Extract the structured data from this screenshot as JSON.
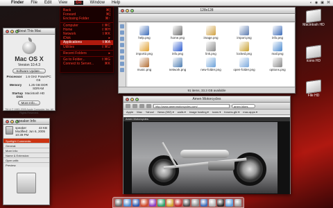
{
  "menubar": {
    "apple": "",
    "app": "Finder",
    "items": [
      "File",
      "Edit",
      "View",
      "Go",
      "Window",
      "Help"
    ],
    "right_glyphs": [
      "◐",
      "◉",
      "▣",
      "⌘"
    ]
  },
  "go_menu": {
    "items": [
      {
        "label": "Back",
        "key": "⌘["
      },
      {
        "label": "Forward",
        "key": "⌘]"
      },
      {
        "label": "Enclosing Folder",
        "key": "⌘↑"
      },
      {
        "sep": true
      },
      {
        "label": "Computer",
        "key": "⇧⌘C"
      },
      {
        "label": "Home",
        "key": "⇧⌘H"
      },
      {
        "label": "Network",
        "key": "⇧⌘K"
      },
      {
        "label": "iDisk",
        "key": "▸"
      },
      {
        "label": "Applications",
        "key": "⇧⌘A"
      },
      {
        "label": "Utilities",
        "key": "⇧⌘U"
      },
      {
        "sep": true
      },
      {
        "label": "Recent Folders",
        "key": "▸"
      },
      {
        "sep": true
      },
      {
        "label": "Go to Folder...",
        "key": "⇧⌘G"
      },
      {
        "label": "Connect to Server...",
        "key": "⌘K"
      }
    ],
    "highlighted": "Applications"
  },
  "about": {
    "title": "About This Mac",
    "os": "Mac OS X",
    "version": "Version 10.4.3",
    "update_btn": "Software Update...",
    "rows": [
      {
        "k": "Processor",
        "v": "1.6 GHz PowerPC G5"
      },
      {
        "k": "Memory",
        "v": "1.25 GB DDR SDRAM"
      },
      {
        "k": "Startup Disk",
        "v": "Macintosh HD"
      }
    ],
    "more_btn": "More Info...",
    "footer": "TM & © 1983-2005 Apple Computer, Inc. All Rights Reserved."
  },
  "finder": {
    "title": "128x128",
    "status": "91 items, 33.3 GB available",
    "files": [
      {
        "name": "help.png",
        "color": "#3a6ab8"
      },
      {
        "name": "home.png",
        "color": "#6a6a6a"
      },
      {
        "name": "image.png",
        "color": "#d0a040"
      },
      {
        "name": "import.png",
        "color": "#5a7ab0"
      },
      {
        "name": "info.png",
        "color": "#3a6ab8"
      },
      {
        "name": "import2.png",
        "color": "#e0a030"
      },
      {
        "name": "info.png",
        "color": "#2a5ad0"
      },
      {
        "name": "link.png",
        "color": "#8a8a8a"
      },
      {
        "name": "locked.png",
        "color": "#c8a030"
      },
      {
        "name": "mail.png",
        "color": "#4a8ad0"
      },
      {
        "name": "music.png",
        "color": "#b06a30"
      },
      {
        "name": "network.png",
        "color": "#4a7ab0"
      },
      {
        "name": "new-folder.png",
        "color": "#6aa0d8"
      },
      {
        "name": "open-folder.png",
        "color": "#7aa8dc"
      },
      {
        "name": "options.png",
        "color": "#888888"
      }
    ]
  },
  "speaker_info": {
    "title": "speaker Info",
    "name": "speaker",
    "size": "43 KB",
    "modified": "Modified: Jun 6, 2005 10:39 PM",
    "sections": [
      "Spotlight Comments:",
      "General:",
      "More Info:",
      "Name & Extension:",
      "Open with:",
      "Preview:"
    ],
    "highlighted": "Spotlight Comments:"
  },
  "browser": {
    "title": "Amen Motorcycles",
    "url": "http://www.amenmotorcycles.com/",
    "search": "amen bikes",
    "bookmarks": [
      "Apple",
      "Mac",
      "Yahoo!",
      "News (592) ▾",
      "walls ▾",
      "image hosting ▾",
      "icons ▾",
      "forums-gfx ▾",
      "mac-apps ▾"
    ],
    "content_bar": "Amen Motorcycles"
  },
  "desktop": [
    {
      "label": "Macintosh HD"
    },
    {
      "label": "icons HD"
    },
    {
      "label": "File HD"
    }
  ],
  "dock": {
    "colors": [
      "#666",
      "#4a8ad0",
      "#2a5ab0",
      "#d04a2a",
      "#8a3ac0",
      "#2aa06a",
      "#d0a030",
      "#c02a2a",
      "#4a4a4a",
      "#888",
      "#3a6ab8",
      "#b0b0b0",
      "#2a2a2a",
      "#5a9ad8",
      "#999"
    ]
  }
}
